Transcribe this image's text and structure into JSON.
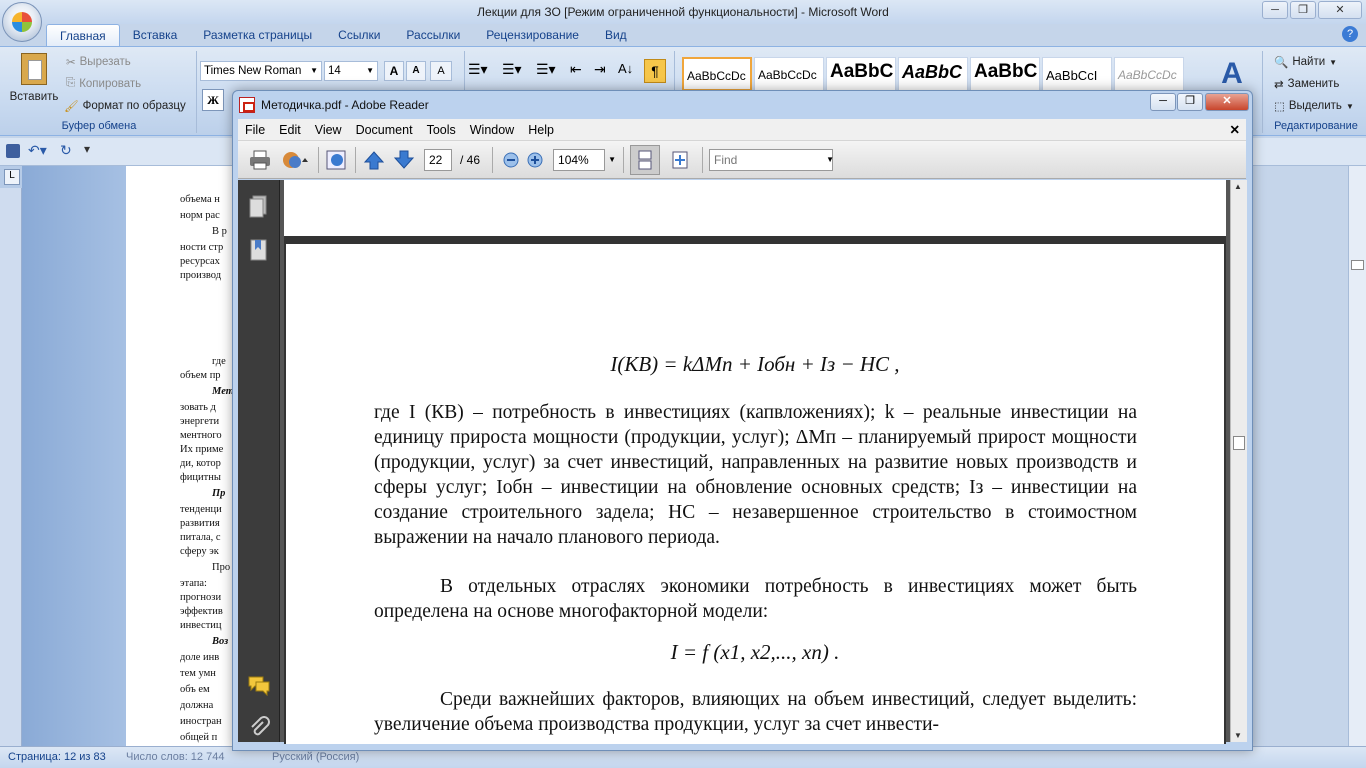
{
  "word": {
    "title": "Лекции для ЗО [Режим ограниченной функциональности] - Microsoft Word",
    "tabs": [
      "Главная",
      "Вставка",
      "Разметка страницы",
      "Ссылки",
      "Рассылки",
      "Рецензирование",
      "Вид"
    ],
    "clipboard": {
      "paste": "Вставить",
      "cut": "Вырезать",
      "copy": "Копировать",
      "format_painter": "Формат по образцу",
      "group_label": "Буфер обмена"
    },
    "font": {
      "name": "Times New Roman",
      "size": "14",
      "bold": "Ж"
    },
    "styles": [
      "AaBbCcDc",
      "AaBbCcDc",
      "AaBbC",
      "AaBbC",
      "AaBbC",
      "AaBbCcI",
      "AaBbCcDc"
    ],
    "editing": {
      "find": "Найти",
      "replace": "Заменить",
      "select": "Выделить",
      "group_label": "Редактирование"
    },
    "doc_lines": [
      "объема н",
      "норм рас",
      "В р",
      "ности стр",
      "ресурсах",
      "производ",
      "где",
      "объем пр",
      "Мет",
      "зовать д",
      "энергети",
      "ментного",
      "Их приме",
      "ди, котор",
      "фицитны",
      "Пр",
      "тенденци",
      "развития",
      "питала, с",
      "сферу эк",
      "Про",
      "этапа:",
      "прогнози",
      "эффектив",
      "инвестиц",
      "Воз",
      "доле инв",
      "тем умн",
      "объ ем",
      "должна",
      "иностран",
      "общей п"
    ],
    "status": {
      "page": "Страница: 12 из 83",
      "words": "Число слов: 12 744",
      "language": "Русский (Россия)"
    }
  },
  "reader": {
    "title": "Методичка.pdf - Adobe Reader",
    "menu": [
      "File",
      "Edit",
      "View",
      "Document",
      "Tools",
      "Window",
      "Help"
    ],
    "page_current": "22",
    "page_total": "/ 46",
    "zoom": "104%",
    "find_placeholder": "Find",
    "content": {
      "formula1": "I(КВ) = kΔMп + Iобн + Iз − НС ,",
      "para1": "где I (КВ) – потребность в инвестициях (капвложениях); k – реальные инвестиции на единицу прироста мощности (продукции, услуг); ΔMп – планируемый прирост мощности (продукции, услуг) за счет инвестиций, направленных на развитие новых производств и сферы услуг; Iобн – инвестиции на обновление основных средств; Iз – инвестиции на создание строительного задела; НС – незавершенное строительство в стоимостном выражении на начало планового периода.",
      "para2": "В отдельных отраслях экономики потребность в инвестициях может быть определена на основе многофакторной модели:",
      "formula2": "I = f (x1, x2,..., xn) .",
      "para3": "Среди важнейших факторов, влияющих на объем инвестиций, следует выделить: увеличение объема производства продукции, услуг за счет инвести-"
    }
  }
}
